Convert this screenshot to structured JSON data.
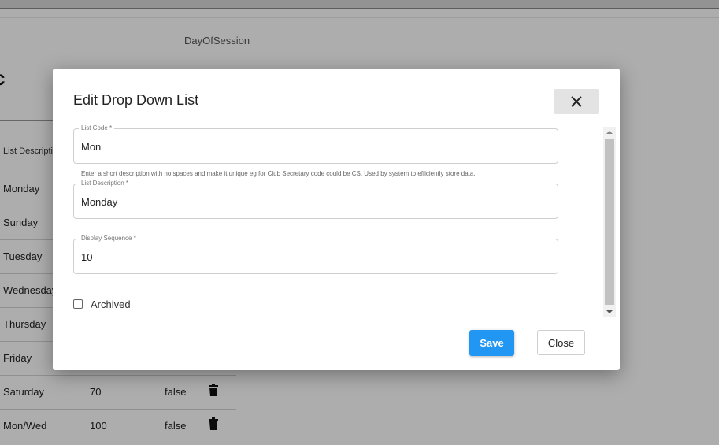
{
  "background": {
    "field_label": "DayOfSession",
    "heading": "c",
    "table": {
      "header": "List Descripti",
      "rows": [
        {
          "description": "Monday",
          "sequence": "",
          "archived": ""
        },
        {
          "description": "Sunday",
          "sequence": "",
          "archived": ""
        },
        {
          "description": "Tuesday",
          "sequence": "",
          "archived": ""
        },
        {
          "description": "Wednesday",
          "sequence": "",
          "archived": ""
        },
        {
          "description": "Thursday",
          "sequence": "",
          "archived": ""
        },
        {
          "description": "Friday",
          "sequence": "",
          "archived": ""
        },
        {
          "description": "Saturday",
          "sequence": "70",
          "archived": "false"
        },
        {
          "description": "Mon/Wed",
          "sequence": "100",
          "archived": "false"
        }
      ]
    }
  },
  "dialog": {
    "title": "Edit Drop Down List",
    "fields": {
      "list_code": {
        "label": "List Code *",
        "value": "Mon"
      },
      "list_code_helper": "Enter a short description with no spaces and make it unique eg for Club Secretary code could be CS. Used by system to efficiently store data.",
      "list_description": {
        "label": "List Description *",
        "value": "Monday"
      },
      "display_sequence": {
        "label": "Display Sequence *",
        "value": "10"
      }
    },
    "archived": {
      "label": "Archived",
      "checked": false
    },
    "buttons": {
      "save": "Save",
      "close": "Close"
    }
  },
  "icons": {
    "close": "close-icon",
    "delete": "trash-icon",
    "checkbox": "checkbox-unchecked"
  },
  "colors": {
    "primary": "#2196f3",
    "overlay": "rgba(0,0,0,0.32)"
  }
}
